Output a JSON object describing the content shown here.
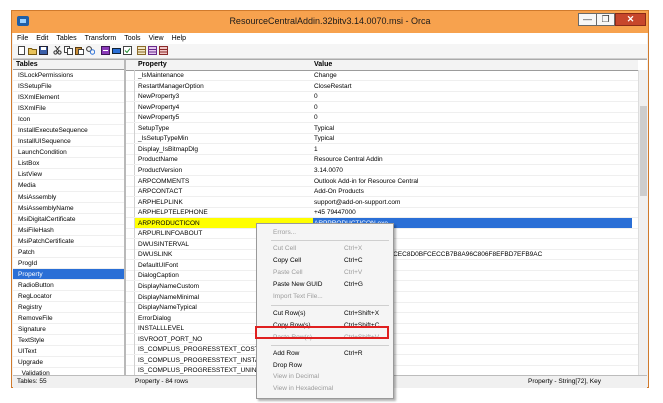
{
  "window": {
    "title": "ResourceCentralAddin.32bitv3.14.0070.msi - Orca",
    "min": "—",
    "max": "❐",
    "close": "✕"
  },
  "menu": [
    "File",
    "Edit",
    "Tables",
    "Transform",
    "Tools",
    "View",
    "Help"
  ],
  "tables": {
    "header": "Tables",
    "items": [
      "ISLockPermissions",
      "ISSetupFile",
      "ISXmlElement",
      "ISXmlFile",
      "Icon",
      "InstallExecuteSequence",
      "InstallUISequence",
      "LaunchCondition",
      "ListBox",
      "ListView",
      "Media",
      "MsiAssembly",
      "MsiAssemblyName",
      "MsiDigitalCertificate",
      "MsiFileHash",
      "MsiPatchCertificate",
      "Patch",
      "ProgId",
      "Property",
      "RadioButton",
      "RegLocator",
      "Registry",
      "RemoveFile",
      "Signature",
      "TextStyle",
      "UIText",
      "Upgrade",
      "_Validation"
    ],
    "selected": "Property"
  },
  "grid": {
    "col_property": "Property",
    "col_value": "Value",
    "rows": [
      {
        "p": "_IsMaintenance",
        "v": "Change"
      },
      {
        "p": "RestartManagerOption",
        "v": "CloseRestart"
      },
      {
        "p": "NewProperty3",
        "v": "0"
      },
      {
        "p": "NewProperty4",
        "v": "0"
      },
      {
        "p": "NewProperty5",
        "v": "0"
      },
      {
        "p": "SetupType",
        "v": "Typical"
      },
      {
        "p": "_IsSetupTypeMin",
        "v": "Typical"
      },
      {
        "p": "Display_IsBitmapDlg",
        "v": "1"
      },
      {
        "p": "ProductName",
        "v": "Resource Central Addin"
      },
      {
        "p": "ProductVersion",
        "v": "3.14.0070"
      },
      {
        "p": "ARPCOMMENTS",
        "v": "Outlook Add-in for Resource Central"
      },
      {
        "p": "ARPCONTACT",
        "v": "Add-On Products"
      },
      {
        "p": "ARPHELPLINK",
        "v": "support@add-on-support.com"
      },
      {
        "p": "ARPHELPTELEPHONE",
        "v": "+45 79447000"
      },
      {
        "p": "ARPPRODUCTICON",
        "v": "ARPPRODUCTICON.exe"
      },
      {
        "p": "ARPURLINFOABOUT",
        "v": ""
      },
      {
        "p": "DWUSINTERVAL",
        "v": ""
      },
      {
        "p": "DWUSLINK",
        "v": "                           CE8CECC978FCEFBC78FCEC8D0BFCECCB7B8A96C806F8EFBD7EFB9AC"
      },
      {
        "p": "DefaultUIFont",
        "v": ""
      },
      {
        "p": "DialogCaption",
        "v": "                                       staller"
      },
      {
        "p": "DisplayNameCustom",
        "v": ""
      },
      {
        "p": "DisplayNameMinimal",
        "v": ""
      },
      {
        "p": "DisplayNameTypical",
        "v": ""
      },
      {
        "p": "ErrorDialog",
        "v": ""
      },
      {
        "p": "INSTALLLEVEL",
        "v": ""
      },
      {
        "p": "ISVROOT_PORT_NO",
        "v": ""
      },
      {
        "p": "IS_COMPLUS_PROGRESSTEXT_COST",
        "v": "                                                 [1]"
      },
      {
        "p": "IS_COMPLUS_PROGRESSTEXT_INSTALL",
        "v": "                                                 ss: [1]"
      },
      {
        "p": "IS_COMPLUS_PROGRESSTEXT_UNINSTALL",
        "v": "                                                 ication: [1]"
      }
    ]
  },
  "context_menu": {
    "errors": "Errors...",
    "cut_cell": "Cut Cell",
    "cut_cell_sc": "Ctrl+X",
    "copy_cell": "Copy Cell",
    "copy_cell_sc": "Ctrl+C",
    "paste_cell": "Paste Cell",
    "paste_cell_sc": "Ctrl+V",
    "paste_guid": "Paste New GUID",
    "paste_guid_sc": "Ctrl+G",
    "import_text": "Import Text File...",
    "cut_rows": "Cut Row(s)",
    "cut_rows_sc": "Ctrl+Shift+X",
    "copy_rows": "Copy Row(s)",
    "copy_rows_sc": "Ctrl+Shift+C",
    "paste_rows": "Paste Row(s)",
    "paste_rows_sc": "Ctrl+Shift+V",
    "add_row": "Add Row",
    "add_row_sc": "Ctrl+R",
    "drop_row": "Drop Row",
    "view_decimal": "View in Decimal",
    "view_hex": "View in Hexadecimal"
  },
  "status": {
    "tables": "Tables: 55",
    "rows": "Property - 84 rows",
    "column": "Property - String[72], Key"
  }
}
